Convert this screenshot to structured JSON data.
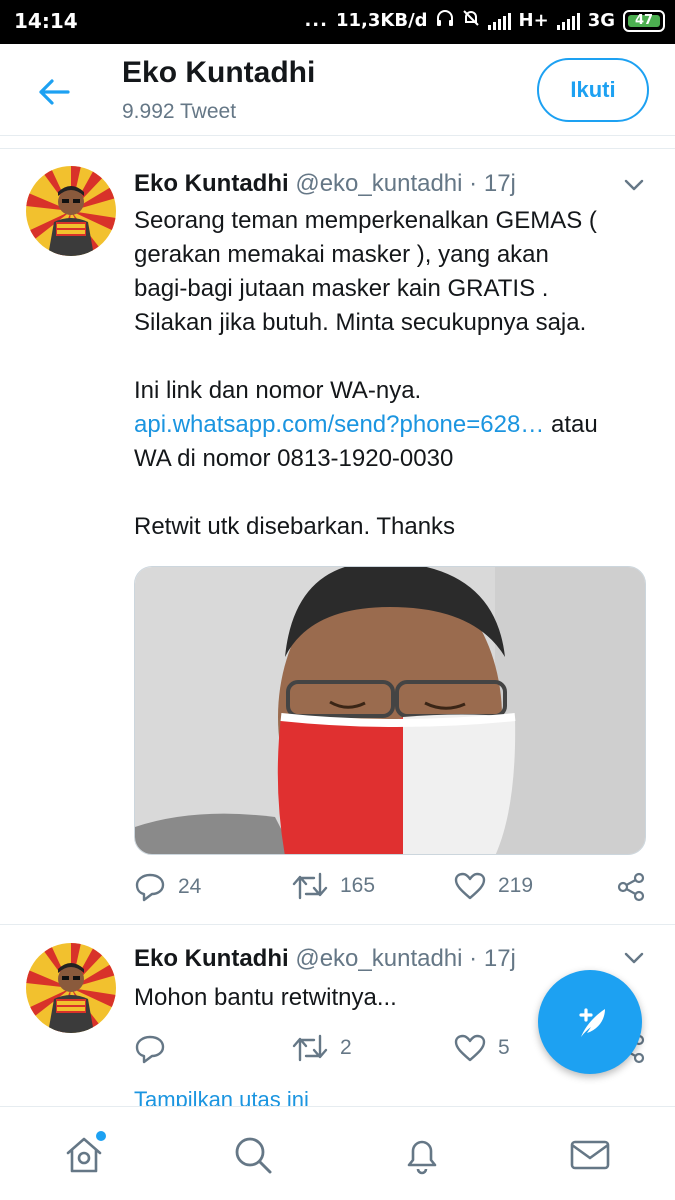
{
  "status_bar": {
    "time": "14:14",
    "dots": "...",
    "speed": "11,3KB/d",
    "network1": "H+",
    "network2": "3G",
    "battery": "47"
  },
  "header": {
    "name": "Eko Kuntadhi",
    "tweet_count": "9.992 Tweet",
    "follow_label": "Ikuti"
  },
  "colors": {
    "accent": "#1da1f2",
    "link": "#1b95e0",
    "muted": "#657786"
  },
  "tweets": [
    {
      "name": "Eko Kuntadhi",
      "handle": "@eko_kuntadhi",
      "separator": "·",
      "time": "17j",
      "lines": [
        "Seorang teman memperkenalkan GEMAS  (",
        "gerakan memakai masker ),  yang akan",
        "bagi-bagi jutaan masker kain GRATIS .",
        "Silakan jika butuh. Minta secukupnya saja."
      ],
      "lines2_text": "Ini link dan nomor WA-nya.",
      "link_text": "api.whatsapp.com/send?phone=628…",
      "after_link": " atau",
      "lines3_text": "WA di nomor 0813-1920-0030",
      "closing": "Retwit utk disebarkan. Thanks",
      "replies": "24",
      "retweets": "165",
      "likes": "219"
    },
    {
      "name": "Eko Kuntadhi",
      "handle": "@eko_kuntadhi",
      "separator": "·",
      "time": "17j",
      "text": "Mohon bantu retwitnya...",
      "replies": "",
      "retweets": "2",
      "likes": "5",
      "show_thread": "Tampilkan utas ini"
    }
  ],
  "icons": {
    "back": "arrow-left-icon",
    "caret": "chevron-down-icon",
    "reply": "reply-icon",
    "retweet": "retweet-icon",
    "like": "heart-icon",
    "share": "share-icon",
    "compose": "compose-tweet-icon",
    "home": "home-icon",
    "search": "search-icon",
    "notifications": "bell-icon",
    "messages": "mail-icon"
  }
}
